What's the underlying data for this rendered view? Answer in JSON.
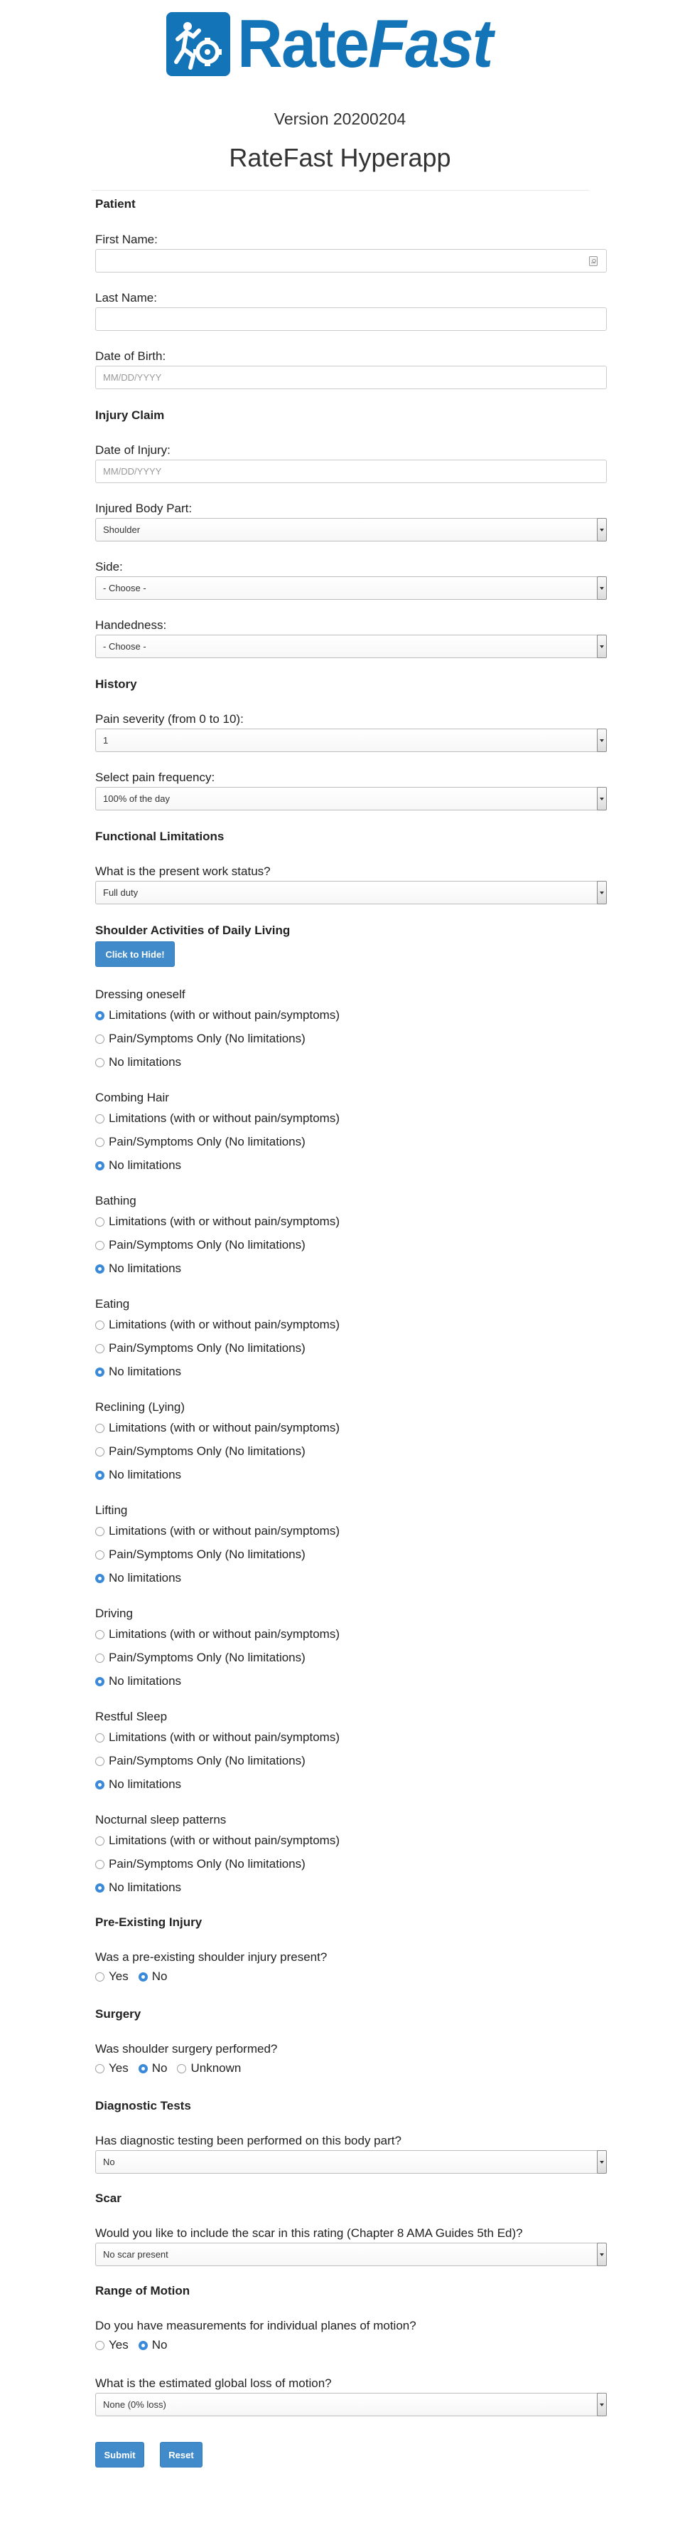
{
  "header": {
    "logo_text_1": "Rate",
    "logo_text_2": "Fast",
    "version": "Version 20200204",
    "title": "RateFast Hyperapp"
  },
  "patient": {
    "section": "Patient",
    "first_name_label": "First Name:",
    "first_name_value": "",
    "last_name_label": "Last Name:",
    "last_name_value": "",
    "dob_label": "Date of Birth:",
    "dob_placeholder": "MM/DD/YYYY"
  },
  "injury_claim": {
    "section": "Injury Claim",
    "doi_label": "Date of Injury:",
    "doi_placeholder": "MM/DD/YYYY",
    "body_part_label": "Injured Body Part:",
    "body_part_value": "Shoulder",
    "side_label": "Side:",
    "side_value": "- Choose -",
    "handedness_label": "Handedness:",
    "handedness_value": "- Choose -"
  },
  "history": {
    "section": "History",
    "pain_severity_label": "Pain severity (from 0 to 10):",
    "pain_severity_value": "1",
    "pain_frequency_label": "Select pain frequency:",
    "pain_frequency_value": "100% of the day"
  },
  "functional": {
    "section": "Functional Limitations",
    "work_status_label": "What is the present work status?",
    "work_status_value": "Full duty"
  },
  "adl": {
    "section": "Shoulder Activities of Daily Living",
    "toggle_label": "Click to Hide!",
    "options": [
      "Limitations (with or without pain/symptoms)",
      "Pain/Symptoms Only (No limitations)",
      "No limitations"
    ],
    "activities": [
      {
        "label": "Dressing oneself",
        "selected": 0
      },
      {
        "label": "Combing Hair",
        "selected": 2
      },
      {
        "label": "Bathing",
        "selected": 2
      },
      {
        "label": "Eating",
        "selected": 2
      },
      {
        "label": "Reclining (Lying)",
        "selected": 2
      },
      {
        "label": "Lifting",
        "selected": 2
      },
      {
        "label": "Driving",
        "selected": 2
      },
      {
        "label": "Restful Sleep",
        "selected": 2
      },
      {
        "label": "Nocturnal sleep patterns",
        "selected": 2
      }
    ]
  },
  "pre_existing": {
    "section": "Pre-Existing Injury",
    "question": "Was a pre-existing shoulder injury present?",
    "options": [
      "Yes",
      "No"
    ],
    "selected": 1
  },
  "surgery": {
    "section": "Surgery",
    "question": "Was shoulder surgery performed?",
    "options": [
      "Yes",
      "No",
      "Unknown"
    ],
    "selected": 1
  },
  "diagnostic": {
    "section": "Diagnostic Tests",
    "question": "Has diagnostic testing been performed on this body part?",
    "value": "No"
  },
  "scar": {
    "section": "Scar",
    "question": "Would you like to include the scar in this rating (Chapter 8 AMA Guides 5th Ed)?",
    "value": "No scar present"
  },
  "rom": {
    "section": "Range of Motion",
    "question": "Do you have measurements for individual planes of motion?",
    "options": [
      "Yes",
      "No"
    ],
    "selected": 1,
    "global_label": "What is the estimated global loss of motion?",
    "global_value": "None (0% loss)"
  },
  "actions": {
    "submit": "Submit",
    "reset": "Reset"
  }
}
